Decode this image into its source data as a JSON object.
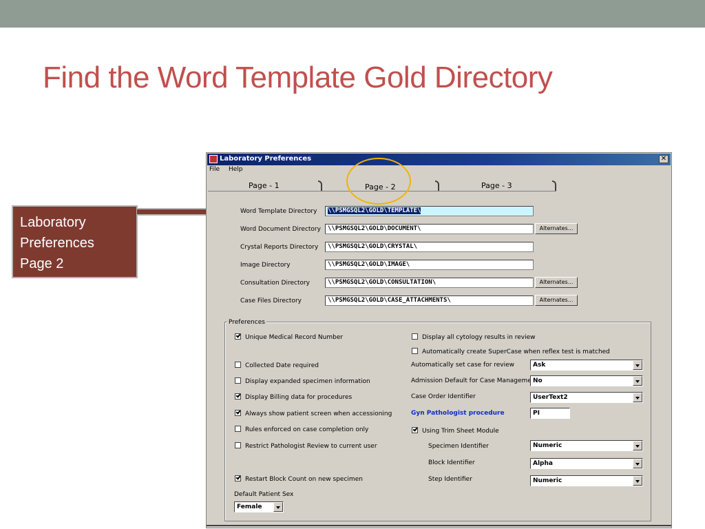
{
  "slide": {
    "title": "Find the Word Template Gold Directory",
    "callout": [
      "Laboratory",
      "Preferences",
      "Page 2"
    ],
    "colors": {
      "title": "#c0504d",
      "callout": "#7f3a30",
      "highlight_circle": "#f0b400",
      "topbar": "#8e9c94"
    }
  },
  "window": {
    "title": "Laboratory Preferences",
    "menu": [
      "File",
      "Help"
    ],
    "tabs": [
      {
        "label": "Page - 1"
      },
      {
        "label": "Page - 2",
        "active": true
      },
      {
        "label": "Page - 3"
      }
    ]
  },
  "directories": [
    {
      "label": "Word Template Directory",
      "value": "\\\\PSMGSQL2\\GOLD\\TEMPLATE\\",
      "alternates": ""
    },
    {
      "label": "Word Document Directory",
      "value": "\\\\PSMGSQL2\\GOLD\\DOCUMENT\\",
      "alternates": "Alternates..."
    },
    {
      "label": "Crystal Reports Directory",
      "value": "\\\\PSMGSQL2\\GOLD\\CRYSTAL\\",
      "alternates": ""
    },
    {
      "label": "Image Directory",
      "value": "\\\\PSMGSQL2\\GOLD\\IMAGE\\",
      "alternates": ""
    },
    {
      "label": "Consultation Directory",
      "value": "\\\\PSMGSQL2\\GOLD\\CONSULTATION\\",
      "alternates": "Alternates..."
    },
    {
      "label": "Case Files Directory",
      "value": "\\\\PSMGSQL2\\GOLD\\CASE_ATTACHMENTS\\",
      "alternates": "Alternates..."
    }
  ],
  "preferences": {
    "title": "Preferences",
    "left": [
      {
        "label": "Unique Medical Record Number",
        "checked": true
      },
      {
        "label": "Collected Date required",
        "checked": false
      },
      {
        "label": "Display expanded specimen information",
        "checked": false
      },
      {
        "label": "Display Billing data for procedures",
        "checked": true
      },
      {
        "label": "Always show patient screen when accessioning",
        "checked": true
      },
      {
        "label": "Rules enforced on case completion only",
        "checked": false
      },
      {
        "label": "Restrict Pathologist Review to current user",
        "checked": false
      },
      {
        "label": "Restart Block Count on new specimen",
        "checked": true
      }
    ],
    "default_sex_label": "Default Patient Sex",
    "default_sex_value": "Female",
    "right_checks": [
      {
        "label": "Display all cytology results in review",
        "checked": false
      },
      {
        "label": "Automatically create SuperCase when reflex test is matched",
        "checked": false
      }
    ],
    "right_fields": [
      {
        "label": "Automatically set case for review",
        "value": "Ask"
      },
      {
        "label": "Admission Default for Case Management",
        "value": "No"
      },
      {
        "label": "Case Order Identifier",
        "value": "UserText2"
      }
    ],
    "gyn_label": "Gyn Pathologist procedure",
    "gyn_value": "PI",
    "trim_label": "Using Trim Sheet Module",
    "trim_checked": true,
    "trim_fields": [
      {
        "label": "Specimen Identifier",
        "value": "Numeric"
      },
      {
        "label": "Block Identifier",
        "value": "Alpha"
      },
      {
        "label": "Step Identifier",
        "value": "Numeric"
      }
    ]
  }
}
